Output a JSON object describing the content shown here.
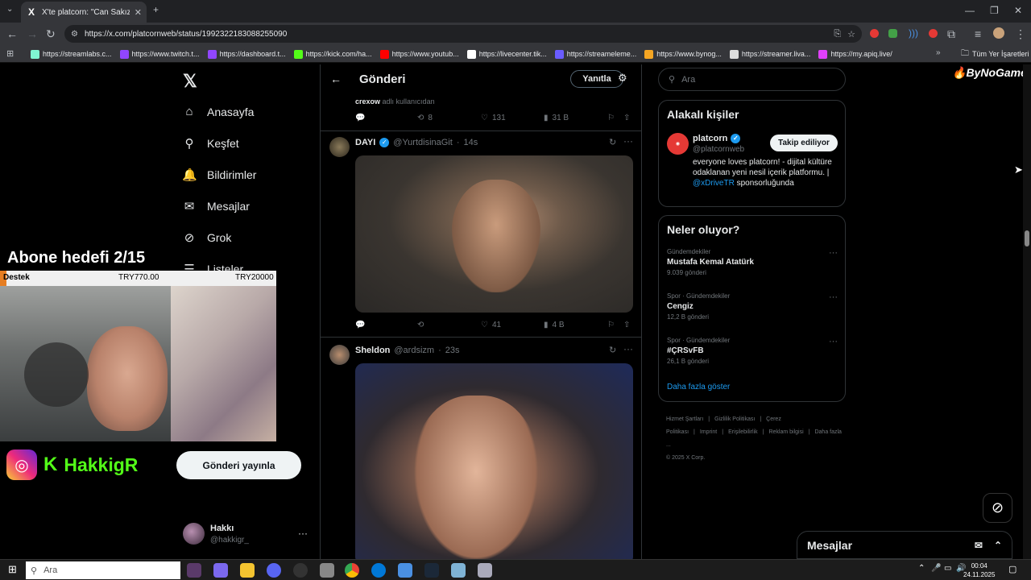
{
  "browser": {
    "tab_title": "X'te platcorn: \"Can Sakızlı, Kick",
    "url": "https://x.com/platcornweb/status/1992322183088255090",
    "bookmarks": [
      {
        "label": "https://streamlabs.c...",
        "color": "#80f5d2"
      },
      {
        "label": "https://www.twitch.t...",
        "color": "#9146ff"
      },
      {
        "label": "https://dashboard.t...",
        "color": "#9146ff"
      },
      {
        "label": "https://kick.com/ha...",
        "color": "#53fc18"
      },
      {
        "label": "https://www.youtub...",
        "color": "#ff0000"
      },
      {
        "label": "https://livecenter.tik...",
        "color": "#ffffff"
      },
      {
        "label": "https://streameleme...",
        "color": "#6a5cff"
      },
      {
        "label": "https://www.bynog...",
        "color": "#f5a623"
      },
      {
        "label": "https://streamer.liva...",
        "color": "#dddddd"
      },
      {
        "label": "https://my.apiq.live/",
        "color": "#e040fb"
      }
    ],
    "all_bookmarks": "Tüm Yer İşaretleri"
  },
  "nav": {
    "items": [
      {
        "label": "Anasayfa",
        "icon": "home-icon",
        "glyph": "⌂"
      },
      {
        "label": "Keşfet",
        "icon": "search-icon",
        "glyph": "⚲"
      },
      {
        "label": "Bildirimler",
        "icon": "bell-icon",
        "glyph": "🔔"
      },
      {
        "label": "Mesajlar",
        "icon": "mail-icon",
        "glyph": "✉"
      },
      {
        "label": "Grok",
        "icon": "grok-icon",
        "glyph": "⊘"
      },
      {
        "label": "Listeler",
        "icon": "list-icon",
        "glyph": "☰"
      }
    ],
    "post_button": "Gönderi yayınla",
    "account_name": "Hakkı",
    "account_handle": "@hakkigr_"
  },
  "overlay": {
    "goal_title": "Abone hedefi 2/15",
    "goal_label": "Destek",
    "goal_current": "TRY770.00",
    "goal_target": "TRY20000",
    "brand_name": "HakkigR"
  },
  "thread": {
    "header_title": "Gönderi",
    "reply_button": "Yanıtla",
    "partial_post": {
      "text_bold": "crexow",
      "text_rest": " adlı kullanıcıdan",
      "retweets": "8",
      "likes": "131",
      "views": "31 B"
    },
    "posts": [
      {
        "name": "DAYI",
        "handle": "@YurtdisinaGit",
        "time": "14s",
        "replies": "",
        "retweets": "",
        "likes": "41",
        "views": "4 B"
      },
      {
        "name": "Sheldon",
        "handle": "@ardsizm",
        "time": "23s"
      }
    ]
  },
  "right": {
    "search_placeholder": "Ara",
    "related_title": "Alakalı kişiler",
    "person": {
      "name": "platcorn",
      "handle": "@platcornweb",
      "follow_label": "Takip ediliyor",
      "bio_1": "everyone loves platcorn! - dijital kültüre odaklanan yeni nesil içerik platformu. |",
      "bio_link": "@xDriveTR",
      "bio_2": "sponsorluğunda"
    },
    "trends_title": "Neler oluyor?",
    "trends": [
      {
        "context": "Gündemdekiler",
        "title": "Mustafa Kemal Atatürk",
        "count": "9.039 gönderi"
      },
      {
        "context": "Spor · Gündemdekiler",
        "title": "Cengiz",
        "count": "12,2 B gönderi"
      },
      {
        "context": "Spor · Gündemdekiler",
        "title": "#ÇRSvFB",
        "count": "26,1 B gönderi"
      }
    ],
    "show_more": "Daha fazla göster",
    "footer_links": [
      "Hizmet Şartları",
      "Gizlilik Politikası",
      "Çerez Politikası",
      "Imprint",
      "Erişilebilirlik",
      "Reklam bilgisi",
      "Daha fazla ..."
    ],
    "copyright": "© 2025 X Corp.",
    "bynogame": "ByNoGame",
    "messages_drawer": "Mesajlar"
  },
  "taskbar": {
    "search_placeholder": "Ara",
    "time": "00:04",
    "date": "24.11.2025"
  }
}
